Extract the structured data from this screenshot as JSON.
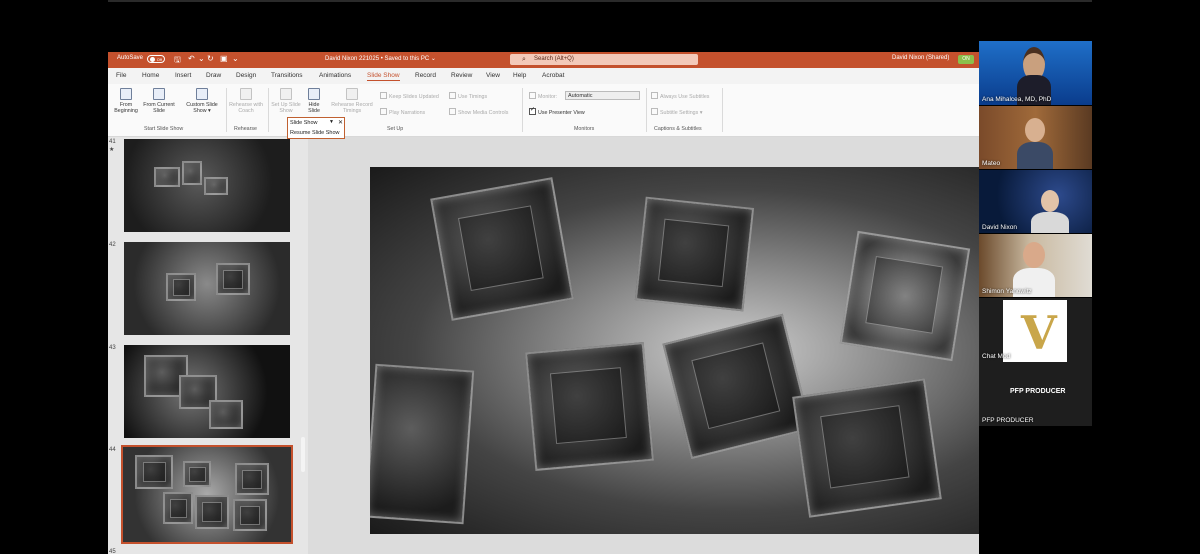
{
  "titlebar": {
    "autosave_label": "AutoSave",
    "autosave_state": "Off",
    "document_title": "David Nixon 221025 • Saved to this PC ⌄",
    "search_placeholder": "Search (Alt+Q)",
    "user_name": "David Nixon (Shared)",
    "presence_badge": "ON"
  },
  "menu": {
    "tabs": [
      "File",
      "Home",
      "Insert",
      "Draw",
      "Design",
      "Transitions",
      "Animations",
      "Slide Show",
      "Record",
      "Review",
      "View",
      "Help",
      "Acrobat"
    ],
    "active_tab": "Slide Show"
  },
  "ribbon": {
    "start_slide_show": {
      "from_beginning": "From Beginning",
      "from_current": "From Current Slide",
      "custom": "Custom Slide Show ▾",
      "group_label": "Start Slide Show"
    },
    "rehearse": {
      "rehearse_with_coach": "Rehearse with Coach",
      "group_label": "Rehearse"
    },
    "setup": {
      "set_up": "Set Up Slide Show",
      "hide_slide": "Hide Slide",
      "rehearse_timings": "Rehearse Record Timings",
      "keep_updated": "Keep Slides Updated",
      "play_narrations": "Play Narrations",
      "use_timings": "Use Timings",
      "show_media_controls": "Show Media Controls",
      "group_label": "Set Up"
    },
    "monitors": {
      "monitor_label": "Monitor:",
      "monitor_value": "Automatic",
      "presenter_view": "Use Presenter View",
      "group_label": "Monitors"
    },
    "captions": {
      "always_subtitles": "Always Use Subtitles",
      "subtitle_settings": "Subtitle Settings ▾",
      "group_label": "Captions & Subtitles"
    }
  },
  "dropdown": {
    "title": "Slide Show",
    "resume": "Resume Slide Show"
  },
  "slides": [
    {
      "number": "41",
      "marker": "★"
    },
    {
      "number": "42"
    },
    {
      "number": "43"
    },
    {
      "number": "44",
      "selected": true
    },
    {
      "number": "45"
    }
  ],
  "participants": [
    {
      "name": "Ana Mihalcea, MD, PhD"
    },
    {
      "name": "Mateo"
    },
    {
      "name": "David Nixon"
    },
    {
      "name": "Shimon Yanowitz"
    },
    {
      "name": "Chat Mod",
      "logo_text": "V",
      "caption": "PFP PRODUCER"
    },
    {
      "name": "PFP PRODUCER"
    }
  ],
  "colors": {
    "accent": "#c4512d",
    "ribbon_bg": "#fafafa",
    "workspace": "#dcdcdc"
  }
}
